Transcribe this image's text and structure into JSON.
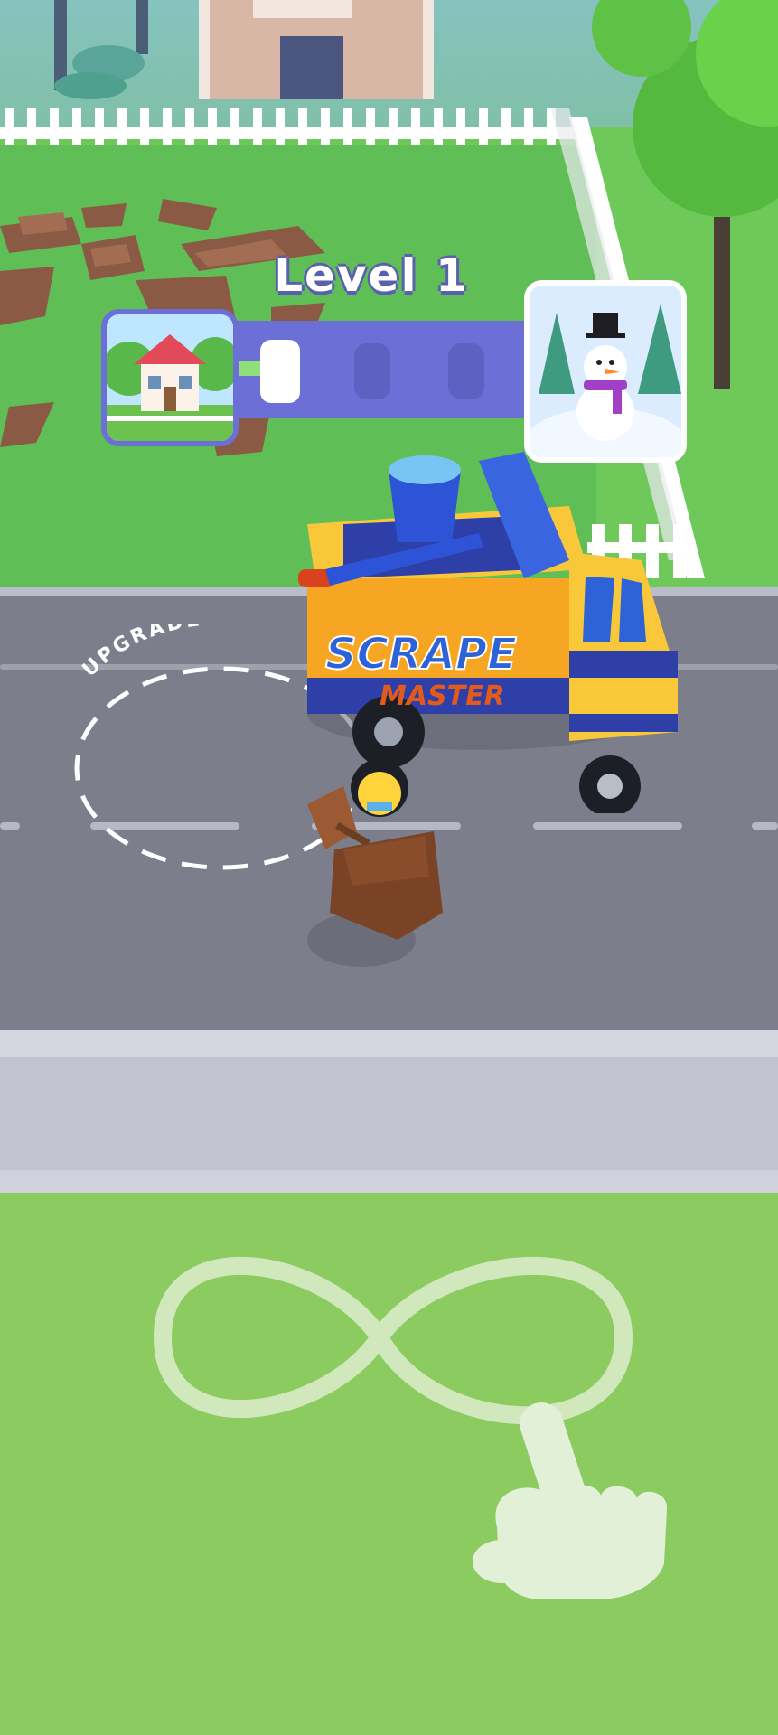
{
  "hud": {
    "level_label": "Level 1",
    "progress": 0.05,
    "current_stage": "house-thumbnail",
    "next_stage": "snowman-thumbnail"
  },
  "world": {
    "upgrade_zone_label": "UPGRADE",
    "truck_brand_line1": "SCRAPE",
    "truck_brand_line2": "MASTER"
  },
  "tutorial": {
    "gesture": "infinity-swipe",
    "hand_icon": "pointing-hand-icon"
  },
  "colors": {
    "accent": "#6b6fd6",
    "progress_fill": "#8fe07a",
    "truck_body": "#f6a623",
    "truck_brand": "#2d63d6",
    "grass": "#8ccb5f",
    "road": "#7c7e8c"
  }
}
